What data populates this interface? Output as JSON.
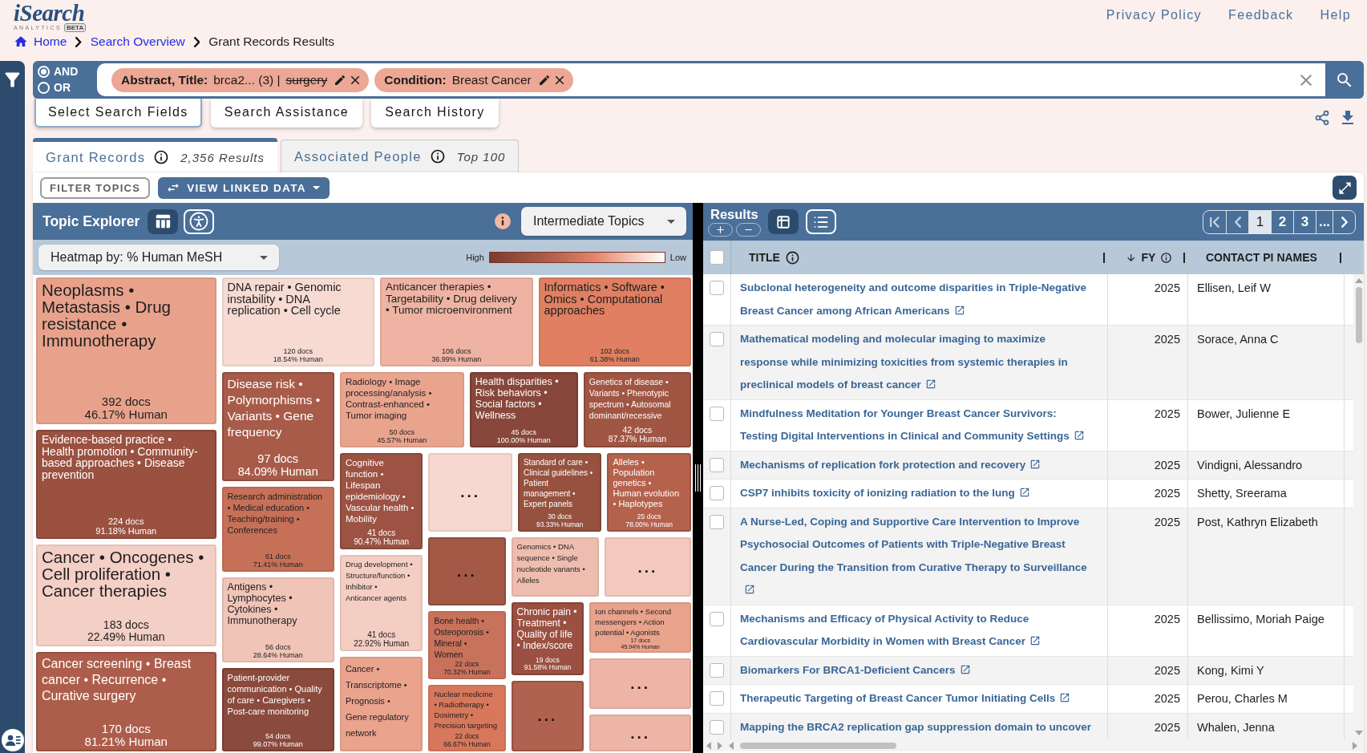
{
  "header": {
    "logo": {
      "wordmark": "iSearch",
      "tagline": "ANALYTICS",
      "badge": "BETA"
    },
    "links": [
      "Privacy Policy",
      "Feedback",
      "Help"
    ]
  },
  "breadcrumb": [
    {
      "label": "Home",
      "kind": "home"
    },
    {
      "label": "Search Overview",
      "kind": "link"
    },
    {
      "label": "Grant Records Results",
      "kind": "current"
    }
  ],
  "search": {
    "operators": [
      {
        "label": "AND",
        "selected": true
      },
      {
        "label": "OR",
        "selected": false
      }
    ],
    "chips": [
      {
        "field": "Abstract, Title:",
        "terms": [
          {
            "text": "brca2... (3) |",
            "struck": false
          },
          {
            "text": "surgery",
            "struck": true
          }
        ]
      },
      {
        "field": "Condition:",
        "terms": [
          {
            "text": "Breast Cancer",
            "struck": false
          }
        ]
      }
    ]
  },
  "search_tools": [
    {
      "label": "Select Search Fields",
      "selected": true
    },
    {
      "label": "Search Assistance",
      "selected": false
    },
    {
      "label": "Search History",
      "selected": false
    }
  ],
  "result_tabs": [
    {
      "label": "Grant Records",
      "note": "2,356 Results",
      "selected": true
    },
    {
      "label": "Associated People",
      "note": "Top 100",
      "selected": false
    }
  ],
  "toolbar": {
    "filter_button": "FILTER TOPICS",
    "linked_data_button": "VIEW LINKED DATA"
  },
  "topic_explorer": {
    "title": "Topic Explorer",
    "views": [
      {
        "kind": "treemap",
        "selected": true
      },
      {
        "kind": "accessible",
        "selected": false
      }
    ],
    "level_select": "Intermediate Topics",
    "heatmap_select": "Heatmap by: % Human MeSH",
    "legend": {
      "high": "High",
      "low": "Low"
    },
    "topics": [
      {
        "kind": "topic",
        "label": "Neoplasms • Metastasis • Drug resistance • Immunotherapy",
        "docs": "392 docs",
        "human": "46.17% Human",
        "color": "#e8a28c"
      },
      {
        "kind": "topic",
        "label": "Evidence-based practice • Health promotion • Community-based approaches • Disease prevention",
        "docs": "224 docs",
        "human": "91.18% Human",
        "color": "#9b5140"
      },
      {
        "kind": "topic",
        "label": "Cancer • Oncogenes • Cell proliferation • Cancer therapies",
        "docs": "183 docs",
        "human": "22.49% Human",
        "color": "#f4cfc5"
      },
      {
        "kind": "topic",
        "label": "Cancer screening • Breast cancer • Recurrence • Curative surgery",
        "docs": "170 docs",
        "human": "81.21% Human",
        "color": "#ad5d4b"
      },
      {
        "kind": "topic",
        "label": "DNA repair • Genomic instability • DNA replication • Cell cycle",
        "docs": "120 docs",
        "human": "18.54% Human",
        "color": "#f7dbd3"
      },
      {
        "kind": "topic",
        "label": "Anticancer therapies • Targetability • Drug delivery • Tumor microenvironment",
        "docs": "106 docs",
        "human": "36.99% Human",
        "color": "#eeb3a3"
      },
      {
        "kind": "topic",
        "label": "Informatics • Software • Omics • Computational approaches",
        "docs": "102 docs",
        "human": "61.38% Human",
        "color": "#e07f62"
      },
      {
        "kind": "topic",
        "label": "Disease risk • Polymorphisms • Variants • Gene frequency",
        "docs": "97 docs",
        "human": "84.09% Human",
        "color": "#a85b49"
      },
      {
        "kind": "topic",
        "label": "Research administration • Medical education • Teaching/training • Conferences",
        "docs": "61 docs",
        "human": "71.41% Human",
        "color": "#c77058"
      },
      {
        "kind": "topic",
        "label": "Antigens • Lymphocytes • Cytokines • Immunotherapy",
        "docs": "56 docs",
        "human": "28.64% Human",
        "color": "#f1c4b8"
      },
      {
        "kind": "topic",
        "label": "Patient-provider communication • Quality of care • Caregivers • Post-care monitoring",
        "docs": "54 docs",
        "human": "99.07% Human",
        "color": "#8a4a3c"
      },
      {
        "kind": "topic",
        "label": "Radiology • Image processing/analysis • Contrast-enhanced • Tumor imaging",
        "docs": "50 docs",
        "human": "45.57% Human",
        "color": "#e9a48e"
      },
      {
        "kind": "topic",
        "label": "Health disparities • Risk behaviors • Social factors • Wellness",
        "docs": "45 docs",
        "human": "100.00% Human",
        "color": "#88473a"
      },
      {
        "kind": "topic",
        "label": "Genetics of disease • Variants • Phenotypic spectrum • Autosomal dominant/recessive",
        "docs": "42 docs",
        "human": "87.37% Human",
        "color": "#a15644"
      },
      {
        "kind": "topic",
        "label": "Cognitive function • Lifespan epidemiology • Vascular health • Mobility",
        "docs": "41 docs",
        "human": "90.47% Human",
        "color": "#9c5343"
      },
      {
        "kind": "topic",
        "label": "Drug development • Structure/function • Inhibitor • Anticancer agents",
        "docs": "41 docs",
        "human": "22.92% Human",
        "color": "#f4cdc3"
      },
      {
        "kind": "topic",
        "label": "Cancer • Transcriptome • Prognosis • Gene regulatory network",
        "color": "#eaa38d"
      },
      {
        "kind": "more",
        "label": "...",
        "color": "#f7d8d0"
      },
      {
        "kind": "topic",
        "label": "Standard of care • Clinical guidelines • Patient management • Expert panels",
        "docs": "30 docs",
        "human": "93.33% Human",
        "color": "#97513f"
      },
      {
        "kind": "topic",
        "label": "Alleles • Population genetics • Human evolution • Haplotypes",
        "docs": "25 docs",
        "human": "78.00% Human",
        "color": "#b5624d"
      },
      {
        "kind": "more",
        "label": "...",
        "color": "#a45846"
      },
      {
        "kind": "topic",
        "label": "Bone health • Osteoporosis • Mineral • Women",
        "docs": "22 docs",
        "human": "70.32% Human",
        "color": "#c9725b"
      },
      {
        "kind": "topic",
        "label": "Nuclear medicine • Radiotherapy • Dosimetry • Precision targeting",
        "docs": "22 docs",
        "human": "66.67% Human",
        "color": "#d7785c"
      },
      {
        "kind": "topic",
        "label": "Genomics • DNA sequence • Single nucleotide variants • Alleles",
        "color": "#efbdaf"
      },
      {
        "kind": "more",
        "label": "...",
        "color": "#f3c8bd"
      },
      {
        "kind": "topic",
        "label": "Chronic pain • Treatment • Quality of life • Index/score",
        "docs": "19 docs",
        "human": "91.58% Human",
        "color": "#9b5041"
      },
      {
        "kind": "more",
        "label": "...",
        "color": "#b1614f"
      },
      {
        "kind": "topic",
        "label": "Ion channels • Second messengers • Action potential • Agonists",
        "docs": "17 docs",
        "human": "45.94% Human",
        "color": "#e9a28c"
      },
      {
        "kind": "more",
        "label": "...",
        "color": "#eeb5a6"
      },
      {
        "kind": "more",
        "label": "...",
        "color": "#eeb5a6"
      }
    ]
  },
  "results": {
    "title": "Results",
    "views": [
      {
        "kind": "grid",
        "selected": true
      },
      {
        "kind": "list",
        "selected": false
      }
    ],
    "pager": {
      "pages": [
        {
          "label": "1",
          "selected": true
        },
        {
          "label": "2",
          "selected": false
        },
        {
          "label": "3",
          "selected": false
        }
      ],
      "more": "..."
    },
    "table": {
      "select_all": {
        "checked": false
      },
      "columns": [
        {
          "label": "TITLE",
          "info": true,
          "sorted": false
        },
        {
          "label": "FY",
          "info": true,
          "sorted": true
        },
        {
          "label": "CONTACT PI NAMES",
          "info": false,
          "sorted": false
        }
      ],
      "rows": [
        {
          "title": "Subclonal heterogeneity and outcome disparities in Triple-Negative Breast Cancer among African Americans",
          "external_link": true,
          "fy": "2025",
          "pi": "Ellisen, Leif W",
          "checked": false
        },
        {
          "title": "Mathematical modeling and molecular imaging to maximize response while minimizing toxicities from systemic therapies in preclinical models of breast cancer",
          "external_link": true,
          "fy": "2025",
          "pi": "Sorace, Anna C",
          "checked": false
        },
        {
          "title": "Mindfulness Meditation for Younger Breast Cancer Survivors: Testing Digital Interventions in Clinical and Community Settings",
          "external_link": true,
          "fy": "2025",
          "pi": "Bower, Julienne E",
          "checked": false
        },
        {
          "title": "Mechanisms of replication fork protection and recovery",
          "external_link": true,
          "fy": "2025",
          "pi": "Vindigni, Alessandro",
          "checked": false
        },
        {
          "title": "CSP7 inhibits toxicity of ionizing radiation to the lung",
          "external_link": true,
          "fy": "2025",
          "pi": "Shetty, Sreerama",
          "checked": false
        },
        {
          "title": "A Nurse-Led, Coping and Supportive Care Intervention to Improve Psychosocial Outcomes of Patients with Triple-Negative Breast Cancer During the Transition from Curative Therapy to Surveillance",
          "external_link": true,
          "fy": "2025",
          "pi": "Post, Kathryn Elizabeth",
          "checked": false
        },
        {
          "title": "Mechanisms and Efficacy of Physical Activity to Reduce Cardiovascular Morbidity in Women with Breast Cancer",
          "external_link": true,
          "fy": "2025",
          "pi": "Bellissimo, Moriah Paige",
          "checked": false
        },
        {
          "title": "Biomarkers For BRCA1-Deficient Cancers",
          "external_link": true,
          "fy": "2025",
          "pi": "Kong, Kimi Y",
          "checked": false
        },
        {
          "title": "Therapeutic Targeting of Breast Cancer Tumor Initiating Cells",
          "external_link": true,
          "fy": "2025",
          "pi": "Perou, Charles M",
          "checked": false
        },
        {
          "title": "Mapping the BRCA2 replication gap suppression domain to uncover",
          "external_link": false,
          "fy": "2025",
          "pi": "Whalen, Jenna",
          "checked": false
        }
      ]
    }
  }
}
